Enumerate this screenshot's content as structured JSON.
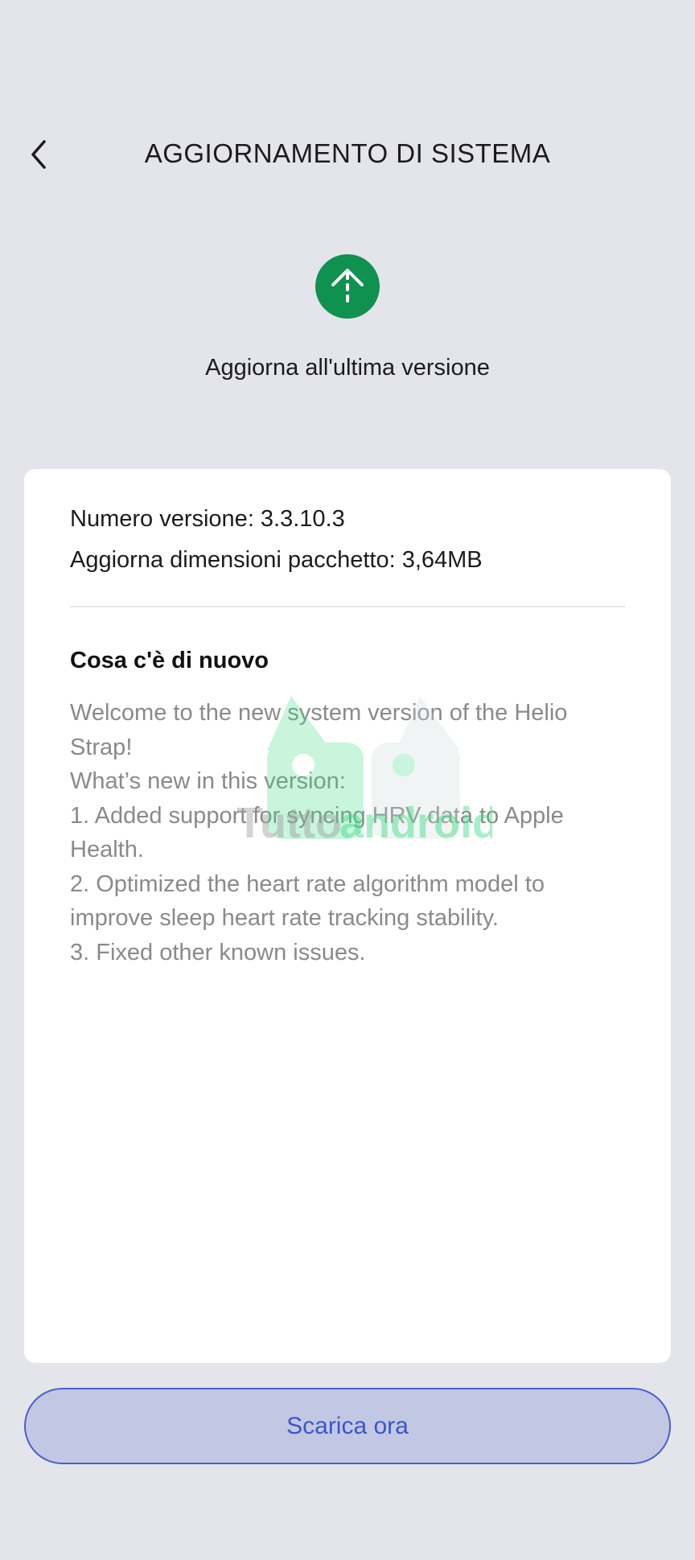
{
  "header": {
    "title": "AGGIORNAMENTO DI SISTEMA",
    "back_icon": "chevron-left-icon"
  },
  "update": {
    "icon": "upload-arrow-icon",
    "icon_color": "#0f9150",
    "subtitle": "Aggiorna all'ultima versione"
  },
  "card": {
    "version_line": "Numero versione: 3.3.10.3",
    "size_line": "Aggiorna dimensioni pacchetto: 3,64MB",
    "whats_new_title": "Cosa c'è di nuovo",
    "notes": [
      "Welcome to the new system version of the Helio",
      "Strap!",
      "What’s new in this version:",
      "1. Added support for syncing HRV data to Apple",
      "Health.",
      "2. Optimized the heart rate algorithm model to",
      "improve sleep heart rate tracking stability.",
      "3. Fixed other known issues."
    ]
  },
  "watermark": {
    "text_a": "Tutto",
    "text_b": "android"
  },
  "download_button": {
    "label": "Scarica ora",
    "accent": "#3d55c9"
  }
}
